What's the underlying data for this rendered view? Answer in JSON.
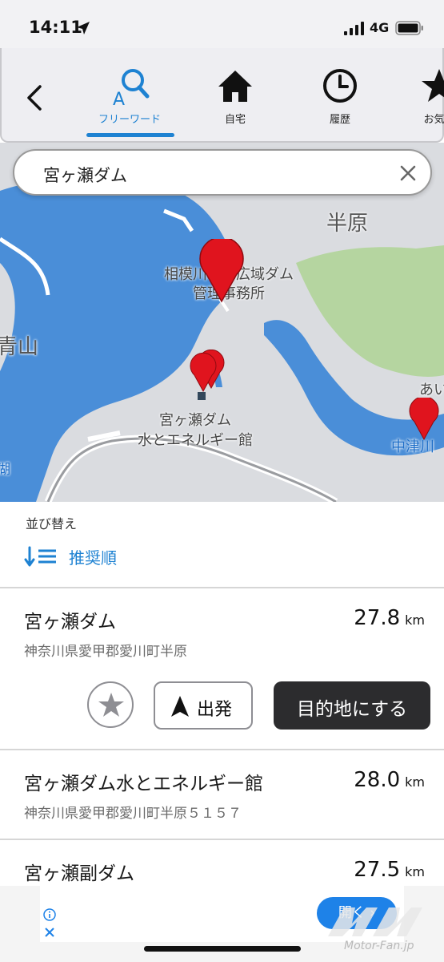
{
  "status_bar": {
    "time": "14:11",
    "network": "4G"
  },
  "nav": {
    "tabs": [
      {
        "label": "フリーワード",
        "icon": "search-a-icon",
        "active": true
      },
      {
        "label": "自宅",
        "icon": "home-icon"
      },
      {
        "label": "履歴",
        "icon": "clock-icon"
      },
      {
        "label": "お気に",
        "icon": "star-icon"
      }
    ]
  },
  "search": {
    "query": "宮ヶ瀬ダム"
  },
  "map": {
    "labels": {
      "hanbara": "半原",
      "aoyama": "青山",
      "sagami_line1": "相模川水系広域ダム",
      "sagami_line2": "管理事務所",
      "museum_line1": "宮ヶ瀬ダム",
      "museum_line2": "水とエネルギー館",
      "nakatsu": "中津川",
      "ai": "あい",
      "ko": "湖"
    }
  },
  "sort": {
    "title": "並び替え",
    "value": "推奨順"
  },
  "results": [
    {
      "name": "宮ヶ瀬ダム",
      "distance": "27.8",
      "unit": "km",
      "address": "神奈川県愛甲郡愛川町半原"
    },
    {
      "name": "宮ヶ瀬ダム水とエネルギー館",
      "distance": "28.0",
      "unit": "km",
      "address": "神奈川県愛甲郡愛川町半原５１５７"
    },
    {
      "name": "宮ヶ瀬副ダム",
      "distance": "27.5",
      "unit": "km"
    }
  ],
  "actions": {
    "depart": "出発",
    "destination": "目的地にする"
  },
  "ad": {
    "open_label": "開く ›"
  },
  "watermark": "Motor-Fan.jp",
  "colors": {
    "accent": "#1e82d2",
    "dark_button": "#2c2c2e",
    "water": "#4a8ed8",
    "park": "#b5d5a0",
    "pin": "#e0141e"
  }
}
